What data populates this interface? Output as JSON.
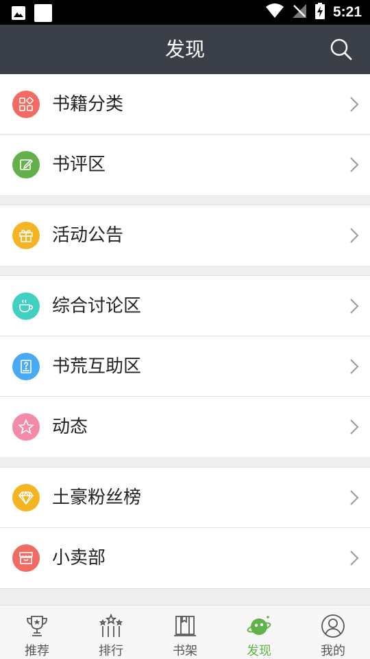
{
  "status_bar": {
    "time": "5:21"
  },
  "app_bar": {
    "title": "发现"
  },
  "colors": {
    "app_bar": "#3b4048",
    "accent_green": "#5fb348"
  },
  "menu": [
    {
      "label": "书籍分类",
      "icon": "grid-icon",
      "color": "#f26b62"
    },
    {
      "label": "书评区",
      "icon": "edit-icon",
      "color": "#62b14b"
    },
    {
      "label": "活动公告",
      "icon": "gift-icon",
      "color": "#f5b522"
    },
    {
      "label": "综合讨论区",
      "icon": "cup-icon",
      "color": "#3fd0c2"
    },
    {
      "label": "书荒互助区",
      "icon": "question-book-icon",
      "color": "#4aa9f3"
    },
    {
      "label": "动态",
      "icon": "star-icon",
      "color": "#f58aa8"
    },
    {
      "label": "土豪粉丝榜",
      "icon": "diamond-icon",
      "color": "#f5b522"
    },
    {
      "label": "小卖部",
      "icon": "shop-icon",
      "color": "#f26b62"
    }
  ],
  "tabs": [
    {
      "label": "推荐",
      "icon": "trophy-icon",
      "active": false
    },
    {
      "label": "排行",
      "icon": "ranking-icon",
      "active": false
    },
    {
      "label": "书架",
      "icon": "bookshelf-icon",
      "active": false
    },
    {
      "label": "发现",
      "icon": "planet-icon",
      "active": true
    },
    {
      "label": "我的",
      "icon": "profile-icon",
      "active": false
    }
  ]
}
